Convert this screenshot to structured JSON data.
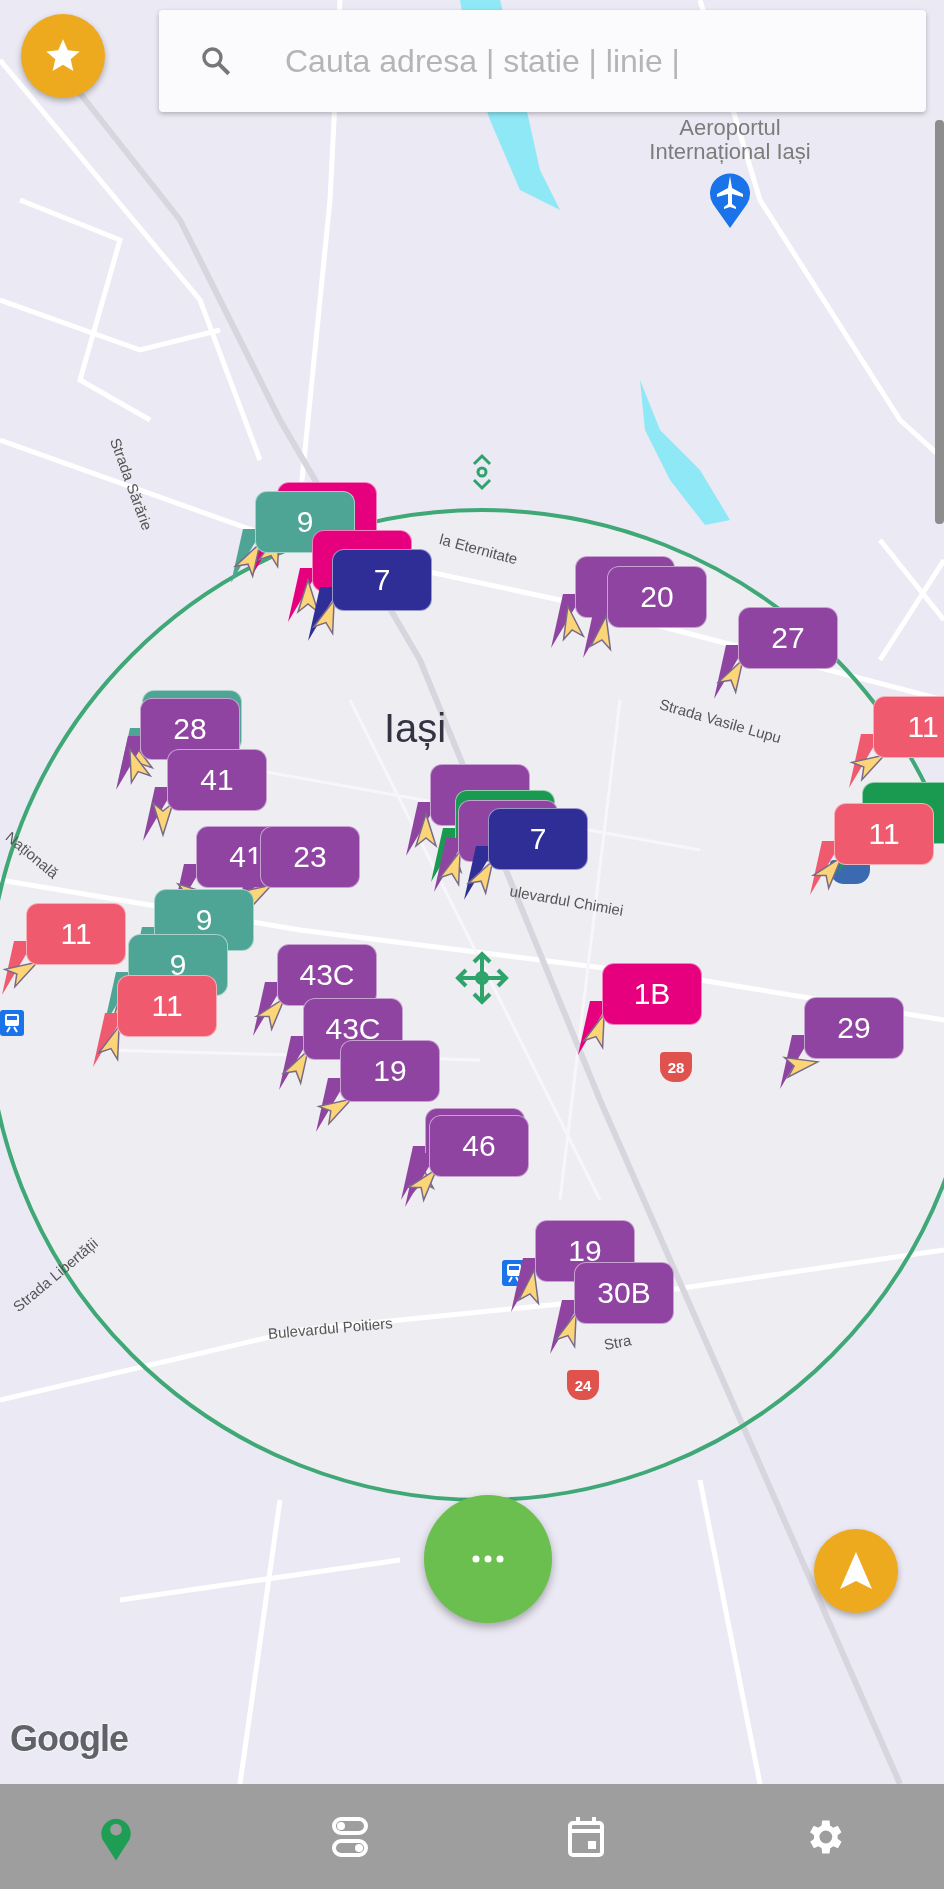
{
  "search": {
    "placeholder": "Cauta adresa | statie | linie |"
  },
  "map_labels": {
    "city": "Iași",
    "airport": "Aeroportul Internațional Iași",
    "streets": [
      "Strada Sărărie",
      "la Eternitate",
      "Strada Vasile Lupu",
      "Națională",
      "ulevardul Chimiei",
      "Strada Libertății",
      "Bulevardul Poitiers",
      "Stra"
    ],
    "road_shields": [
      "28",
      "24"
    ],
    "attribution": "Google"
  },
  "markers": [
    {
      "color": "#e6007e"
    },
    {
      "label": "9",
      "color": "#4fa595"
    },
    {
      "color": "#e6007e"
    },
    {
      "label": "7",
      "color": "#2e2e96"
    },
    {
      "color": "#8e44a0"
    },
    {
      "label": "20",
      "color": "#8e44a0"
    },
    {
      "label": "27",
      "color": "#8e44a0"
    },
    {
      "label": "11",
      "color": "#f05a6e"
    },
    {
      "color": "#1a9a50"
    },
    {
      "label": "11",
      "color": "#f05a6e"
    },
    {
      "color": "#4fa595"
    },
    {
      "label": "28",
      "color": "#8e44a0"
    },
    {
      "label": "41",
      "color": "#8e44a0"
    },
    {
      "label": "41",
      "color": "#8e44a0"
    },
    {
      "label": "23",
      "color": "#8e44a0"
    },
    {
      "color": "#8e44a0"
    },
    {
      "color": "#1a9a50"
    },
    {
      "color": "#8e44a0"
    },
    {
      "label": "7",
      "color": "#2e2e96"
    },
    {
      "label": "9",
      "color": "#4fa595"
    },
    {
      "label": "11",
      "color": "#f05a6e"
    },
    {
      "label": "9",
      "color": "#4fa595"
    },
    {
      "label": "11",
      "color": "#f05a6e"
    },
    {
      "label": "43C",
      "color": "#8e44a0"
    },
    {
      "label": "43C",
      "color": "#8e44a0"
    },
    {
      "label": "19",
      "color": "#8e44a0"
    },
    {
      "label": "1B",
      "color": "#e6007e"
    },
    {
      "label": "29",
      "color": "#8e44a0"
    },
    {
      "color": "#8e44a0"
    },
    {
      "label": "46",
      "color": "#8e44a0"
    },
    {
      "label": "19",
      "color": "#8e44a0"
    },
    {
      "label": "30B",
      "color": "#8e44a0"
    }
  ],
  "bottom_nav": [
    {
      "selected": true
    },
    {
      "selected": false
    },
    {
      "selected": false
    },
    {
      "selected": false
    }
  ]
}
